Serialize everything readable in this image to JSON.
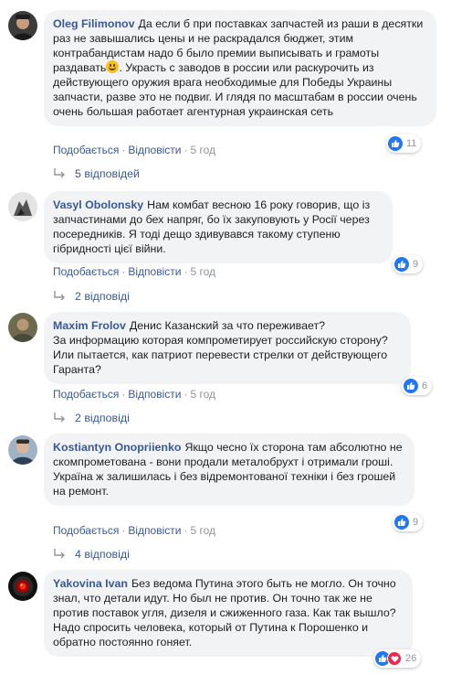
{
  "actions": {
    "like": "Подобається",
    "reply": "Відповісти",
    "separator": "·"
  },
  "comments": [
    {
      "author": "Oleg Filimonov",
      "text_before_emoji": "Да если б при поставках запчастей из раши в десятки раз не завышались цены и не раскрадался бюджет, этим контрабандистам надо б было премии выписывать и грамоты раздавать",
      "emoji": "smiling-face",
      "text_after_emoji": ". Украсть с заводов в россии или раскурочить из действующего оружия врага необходимые для Победы Украины запчасти, разве это не подвиг. И глядя по масштабам в россии очень очень большая работает агентурная украинская сеть",
      "time": "5 год",
      "reaction_count": "11",
      "replies": "5 відповідей"
    },
    {
      "author": "Vasyl Obolonsky",
      "text": "Нам комбат весною 16 року говорив, що із запчастинами до бех напряг, бо їх закуповують у Росії через посередників. Я тоді дещо здивувався такому ступеню гібридності цієї війни.",
      "time": "5 год",
      "reaction_count": "9",
      "replies": "2 відповіді"
    },
    {
      "author": "Maxim Frolov",
      "text": "Денис Казанский за что переживает?\nЗа информацию которая компрометирует российскую сторону? Или пытается, как патриот перевести стрелки от действующего Гаранта?",
      "time": "5 год",
      "reaction_count": "6",
      "replies": "2 відповіді"
    },
    {
      "author": "Kostiantyn Onopriienko",
      "text": "Якщо чесно їх сторона там абсолютно не скомпрометована - вони продали металобрухт і отримали гроші.\nУкраїна ж залишилась і без відремонтованої техніки і без грошей на ремонт.",
      "time": "5 год",
      "reaction_count": "9",
      "replies": "4 відповіді"
    },
    {
      "author": "Yakovina Ivan",
      "text": "Без ведома Путина этого быть не могло. Он точно знал, что детали идут. Но был не против. Он точно так же не против поставок угля, дизеля и сжиженного газа. Как так вышло? Надо спросить человека, который от Путина к Порошенко и обратно постоянно гоняет.",
      "reaction_count": "26"
    }
  ],
  "colors": {
    "link": "#385898",
    "meta": "#90949c",
    "bubble": "#f2f3f5",
    "like": "#2078f4",
    "love": "#f0284a"
  }
}
